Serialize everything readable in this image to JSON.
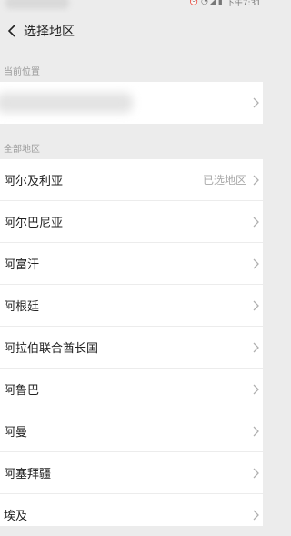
{
  "status_bar": {
    "time": "下午7:31"
  },
  "header": {
    "title": "选择地区"
  },
  "current_section": {
    "label": "当前位置"
  },
  "all_section": {
    "label": "全部地区"
  },
  "regions": [
    {
      "name": "阿尔及利亚",
      "tag": "已选地区"
    },
    {
      "name": "阿尔巴尼亚",
      "tag": ""
    },
    {
      "name": "阿富汗",
      "tag": ""
    },
    {
      "name": "阿根廷",
      "tag": ""
    },
    {
      "name": "阿拉伯联合酋长国",
      "tag": ""
    },
    {
      "name": "阿鲁巴",
      "tag": ""
    },
    {
      "name": "阿曼",
      "tag": ""
    },
    {
      "name": "阿塞拜疆",
      "tag": ""
    },
    {
      "name": "埃及",
      "tag": ""
    }
  ]
}
